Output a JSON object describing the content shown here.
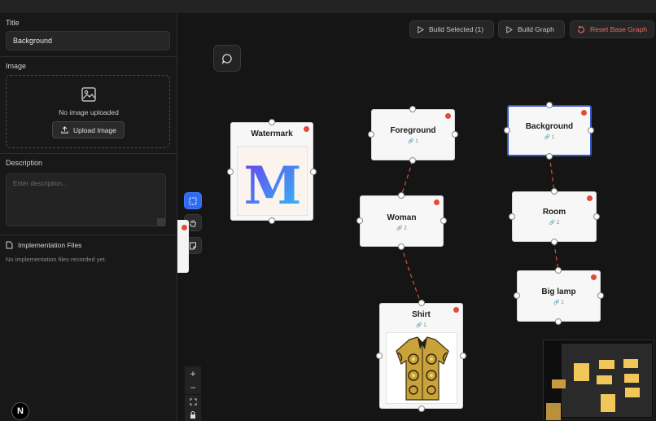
{
  "sidebar": {
    "title_label": "Title",
    "title_value": "Background",
    "image_label": "Image",
    "no_image_text": "No image uploaded",
    "upload_label": "Upload Image",
    "description_label": "Description",
    "description_placeholder": "Enter description...",
    "impl_files_label": "Implementation Files",
    "impl_files_empty": "No implementation files recorded yet."
  },
  "toolbar": {
    "build_selected": "Build Selected (1)",
    "build_graph": "Build Graph",
    "reset_graph": "Reset Base Graph"
  },
  "nodes": {
    "watermark": {
      "title": "Watermark",
      "image_letter": "M"
    },
    "foreground": {
      "title": "Foreground",
      "count": "1"
    },
    "background": {
      "title": "Background",
      "count": "1"
    },
    "woman": {
      "title": "Woman",
      "count": "2"
    },
    "room": {
      "title": "Room",
      "count": "2"
    },
    "big_lamp": {
      "title": "Big lamp",
      "count": "1"
    },
    "shirt": {
      "title": "Shirt",
      "count": "1"
    }
  },
  "logo_letter": "N",
  "colors": {
    "accent": "#2f6bf0",
    "status": "#e04b3b",
    "edge": "#d0493a",
    "selected_border": "#3457c9",
    "minimap_node": "#f2c75a"
  }
}
